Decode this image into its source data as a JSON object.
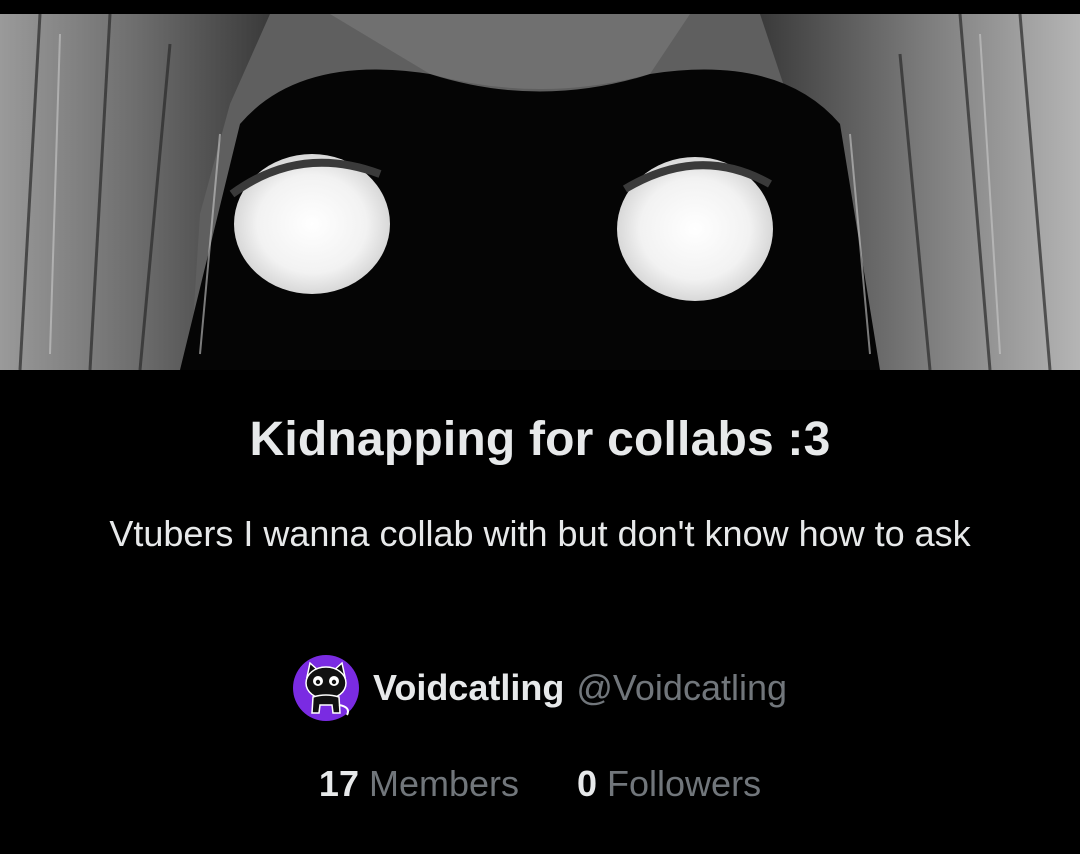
{
  "list": {
    "title": "Kidnapping for collabs :3",
    "description": "Vtubers I wanna collab with but don't know how to ask",
    "banner_icon": "anime-face-banner-image"
  },
  "owner": {
    "display_name": "Voidcatling",
    "handle": "@Voidcatling",
    "avatar_icon": "black-cat-avatar-icon",
    "avatar_bg_color": "#7a2be2"
  },
  "stats": {
    "members_count": "17",
    "members_label": "Members",
    "followers_count": "0",
    "followers_label": "Followers"
  },
  "colors": {
    "background": "#000000",
    "primary_text": "#e7e9ea",
    "secondary_text": "#71767b"
  }
}
